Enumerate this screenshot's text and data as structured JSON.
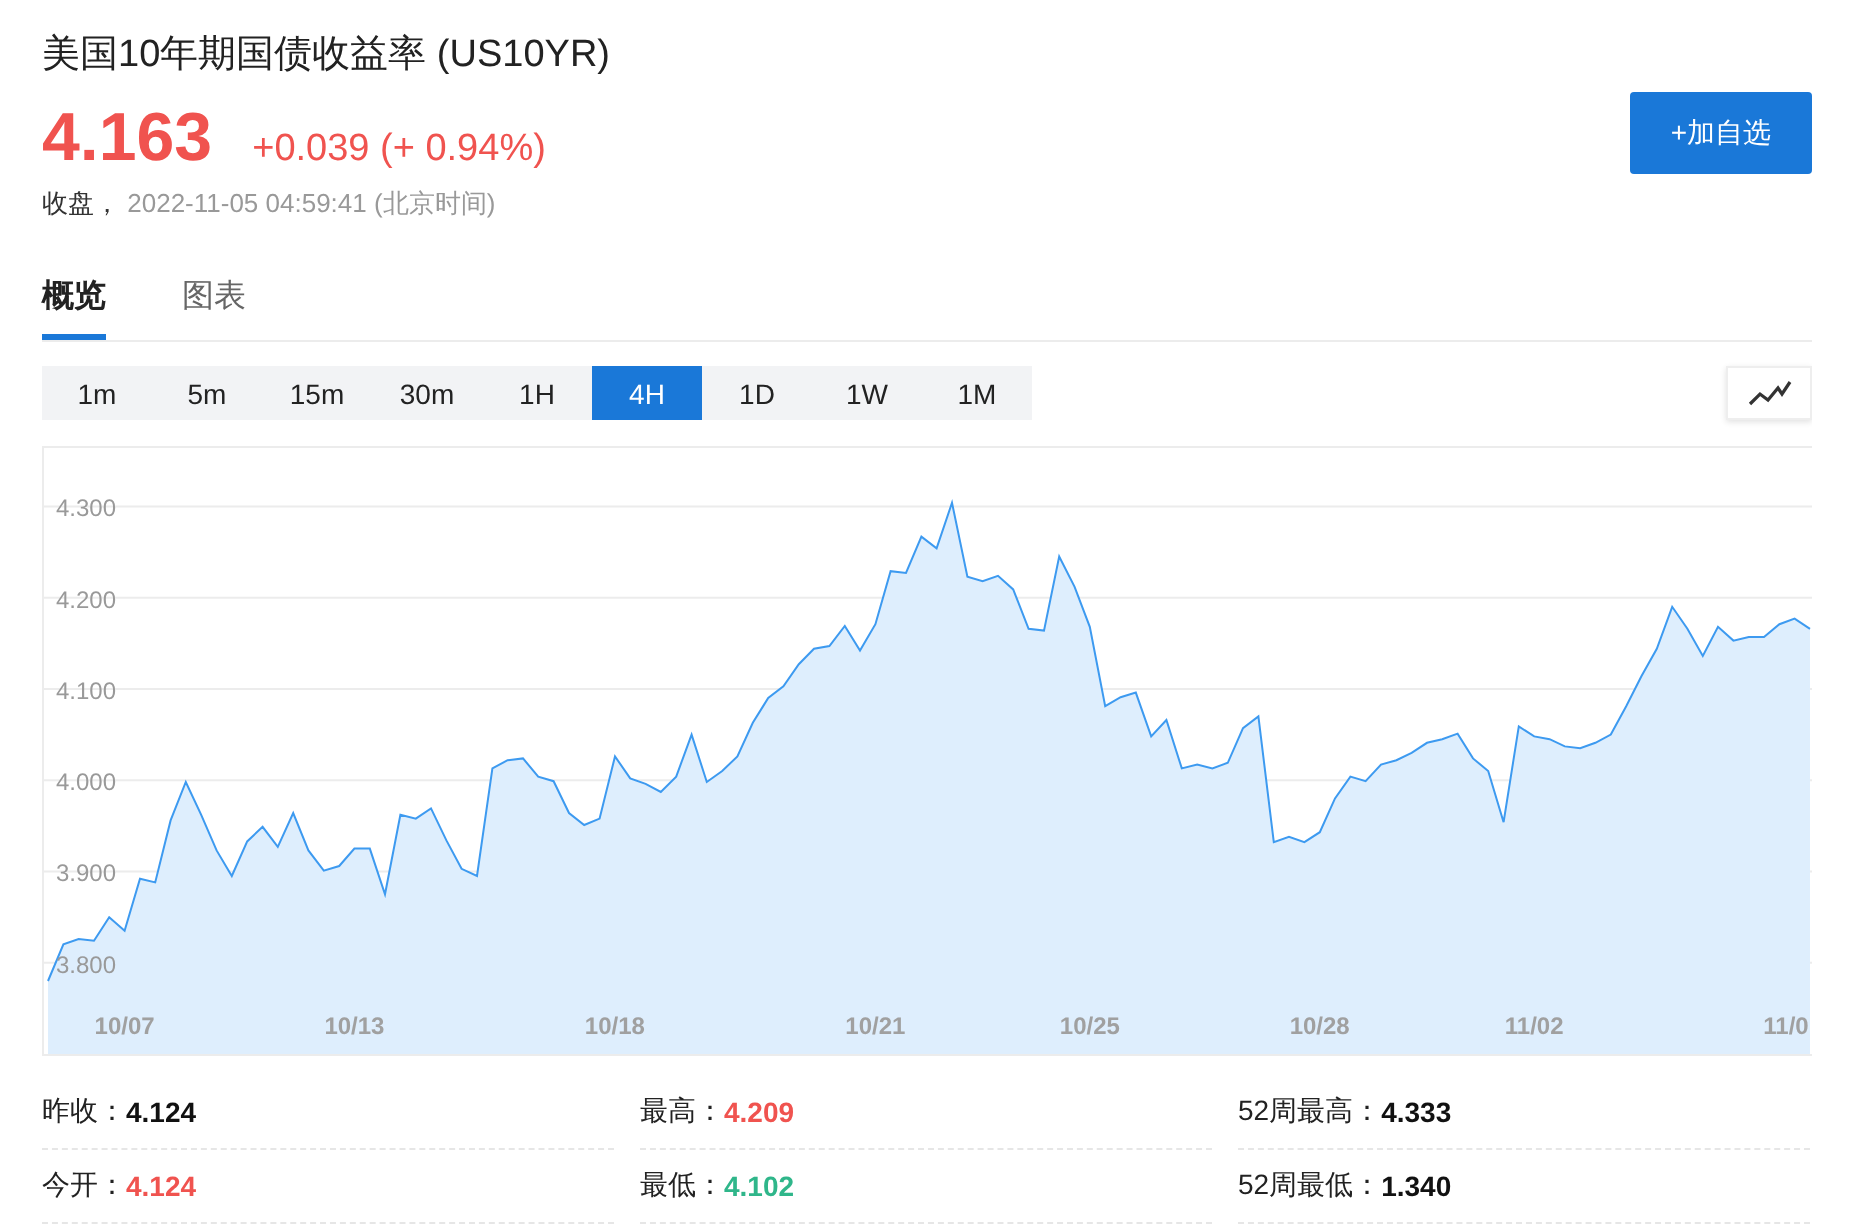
{
  "quote": {
    "title": "美国10年期国债收益率 (US10YR)",
    "price": "4.163",
    "change": "+0.039 (+ 0.94%)",
    "status": "收盘，",
    "time": "2022-11-05 04:59:41 (北京时间)"
  },
  "add_button": "+加自选",
  "tabs": [
    {
      "label": "概览",
      "selected": true
    },
    {
      "label": "图表",
      "selected": false
    }
  ],
  "periods": [
    {
      "label": "1m",
      "selected": false
    },
    {
      "label": "5m",
      "selected": false
    },
    {
      "label": "15m",
      "selected": false
    },
    {
      "label": "30m",
      "selected": false
    },
    {
      "label": "1H",
      "selected": false
    },
    {
      "label": "4H",
      "selected": true
    },
    {
      "label": "1D",
      "selected": false
    },
    {
      "label": "1W",
      "selected": false
    },
    {
      "label": "1M",
      "selected": false
    }
  ],
  "chart": {
    "chart_data": {
      "type": "area",
      "grid": true,
      "ylim": [
        3.7,
        4.364
      ],
      "yticks": [
        {
          "value": 3.8,
          "label": "3.800"
        },
        {
          "value": 3.9,
          "label": "3.900"
        },
        {
          "value": 4.0,
          "label": "4.000"
        },
        {
          "value": 4.1,
          "label": "4.100"
        },
        {
          "value": 4.2,
          "label": "4.200"
        },
        {
          "value": 4.3,
          "label": "4.300"
        }
      ],
      "categories": [
        null,
        null,
        null,
        null,
        null,
        "10/07",
        null,
        null,
        null,
        null,
        null,
        null,
        null,
        null,
        null,
        null,
        null,
        null,
        null,
        null,
        "10/13",
        null,
        null,
        null,
        null,
        null,
        null,
        null,
        null,
        null,
        null,
        null,
        null,
        null,
        null,
        null,
        null,
        "10/18",
        null,
        null,
        null,
        null,
        null,
        null,
        null,
        null,
        null,
        null,
        null,
        null,
        null,
        null,
        null,
        null,
        "10/21",
        null,
        null,
        null,
        null,
        null,
        null,
        null,
        null,
        null,
        null,
        null,
        null,
        null,
        "10/25",
        null,
        null,
        null,
        null,
        null,
        null,
        null,
        null,
        null,
        null,
        null,
        null,
        null,
        null,
        "10/28",
        null,
        null,
        null,
        null,
        null,
        null,
        null,
        null,
        null,
        null,
        null,
        null,
        null,
        "11/02",
        null,
        null,
        null,
        null,
        null,
        null,
        null,
        null,
        null,
        null,
        null,
        null,
        null,
        null,
        null,
        null,
        "11/0",
        null
      ],
      "series": [
        {
          "color": "#3d9af0",
          "values": [
            3.78,
            3.82,
            3.826,
            3.824,
            3.85,
            3.835,
            3.892,
            3.888,
            3.956,
            3.998,
            3.962,
            3.923,
            3.895,
            3.933,
            3.949,
            3.927,
            3.964,
            3.923,
            3.901,
            3.906,
            3.925,
            3.925,
            3.875,
            3.962,
            3.958,
            3.969,
            3.934,
            3.903,
            3.895,
            4.013,
            4.022,
            4.024,
            4.004,
            3.999,
            3.964,
            3.951,
            3.958,
            4.026,
            4.002,
            3.996,
            3.987,
            4.004,
            4.05,
            3.998,
            4.01,
            4.026,
            4.063,
            4.09,
            4.103,
            4.127,
            4.144,
            4.147,
            4.169,
            4.142,
            4.171,
            4.229,
            4.227,
            4.267,
            4.254,
            4.304,
            4.223,
            4.218,
            4.224,
            4.209,
            4.166,
            4.164,
            4.245,
            4.212,
            4.168,
            4.081,
            4.091,
            4.096,
            4.048,
            4.066,
            4.013,
            4.017,
            4.013,
            4.019,
            4.057,
            4.07,
            3.932,
            3.938,
            3.932,
            3.943,
            3.98,
            4.004,
            3.999,
            4.017,
            4.022,
            4.03,
            4.041,
            4.045,
            4.051,
            4.024,
            4.01,
            3.954,
            4.059,
            4.048,
            4.045,
            4.037,
            4.035,
            4.041,
            4.05,
            4.081,
            4.114,
            4.144,
            4.19,
            4.166,
            4.136,
            4.168,
            4.153,
            4.157,
            4.157,
            4.171,
            4.177,
            4.166
          ]
        }
      ]
    }
  },
  "stats": [
    {
      "label": "昨收：",
      "value": "4.124",
      "color": "#111111"
    },
    {
      "label": "最高：",
      "value": "4.209",
      "color": "#f0534f"
    },
    {
      "label": "52周最高：",
      "value": "4.333",
      "color": "#111111"
    },
    {
      "label": "今开：",
      "value": "4.124",
      "color": "#f0534f"
    },
    {
      "label": "最低：",
      "value": "4.102",
      "color": "#2fb68a"
    },
    {
      "label": "52周最低：",
      "value": "1.340",
      "color": "#111111"
    }
  ]
}
